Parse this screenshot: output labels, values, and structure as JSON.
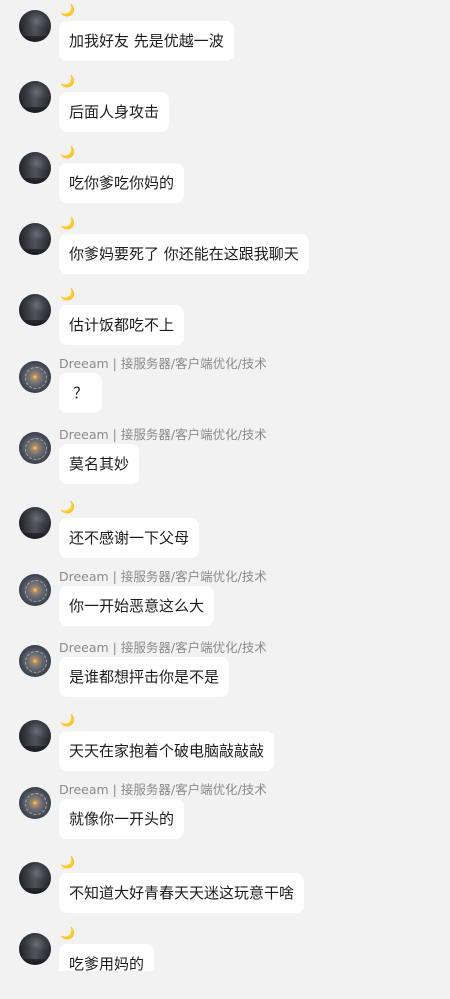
{
  "chat": {
    "user_a_nick": "🌙",
    "user_b_nick": "Dreeam | 接服务器/客户端优化/技术",
    "messages": [
      {
        "sender": "a",
        "text": "加我好友  先是优越一波"
      },
      {
        "sender": "a",
        "text": "后面人身攻击"
      },
      {
        "sender": "a",
        "text": "吃你爹吃你妈的"
      },
      {
        "sender": "a",
        "text": "你爹妈要死了 你还能在这跟我聊天"
      },
      {
        "sender": "a",
        "text": "估计饭都吃不上"
      },
      {
        "sender": "b",
        "text": "？"
      },
      {
        "sender": "b",
        "text": "莫名其妙"
      },
      {
        "sender": "a",
        "text": "还不感谢一下父母"
      },
      {
        "sender": "b",
        "text": "你一开始恶意这么大"
      },
      {
        "sender": "b",
        "text": "是谁都想抨击你是不是"
      },
      {
        "sender": "a",
        "text": "天天在家抱着个破电脑敲敲敲"
      },
      {
        "sender": "b",
        "text": "就像你一开头的"
      },
      {
        "sender": "a",
        "text": "不知道大好青春天天迷这玩意干啥"
      },
      {
        "sender": "a",
        "text": "吃爹用妈的"
      }
    ]
  }
}
